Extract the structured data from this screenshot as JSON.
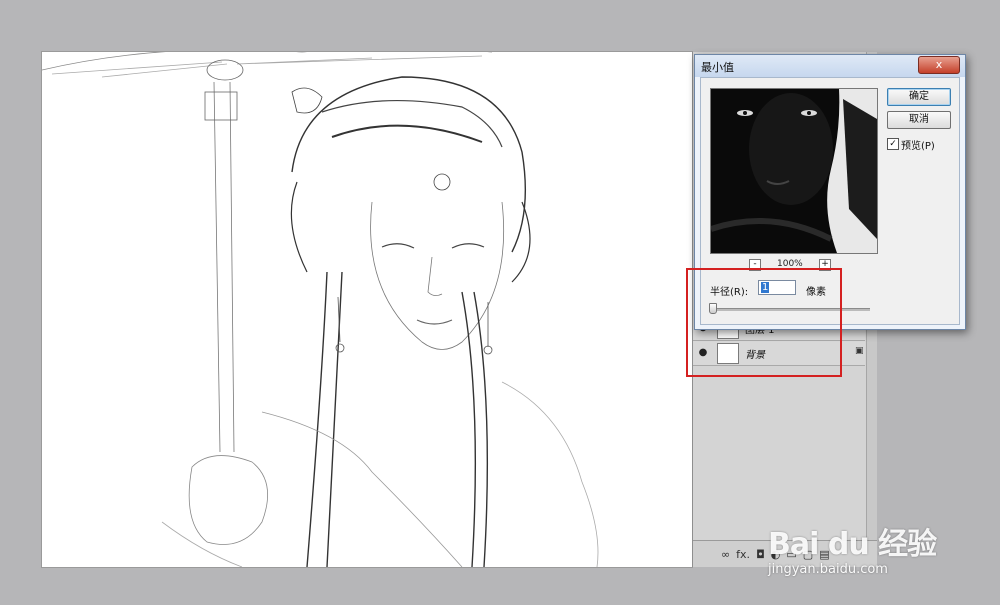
{
  "dialog": {
    "title": "最小值",
    "close_label": "x",
    "ok_label": "确定",
    "cancel_label": "取消",
    "preview_label": "预览(P)",
    "preview_checked": true,
    "zoom_minus": "-",
    "zoom_level": "100%",
    "zoom_plus": "+",
    "radius_label": "半径(R):",
    "radius_value": "1",
    "radius_unit": "像素",
    "radius_slider_value": 1
  },
  "layers": {
    "items": [
      {
        "name": "图层 1"
      },
      {
        "name": "背景",
        "locked": true
      }
    ],
    "toolbar": {
      "link_icon": "∞",
      "fx_label": "fx."
    }
  },
  "watermark": {
    "brand": "Bai du 经验",
    "url": "jingyan.baidu.com"
  },
  "colors": {
    "annotation": "#d42020",
    "selection": "#3078d0"
  }
}
